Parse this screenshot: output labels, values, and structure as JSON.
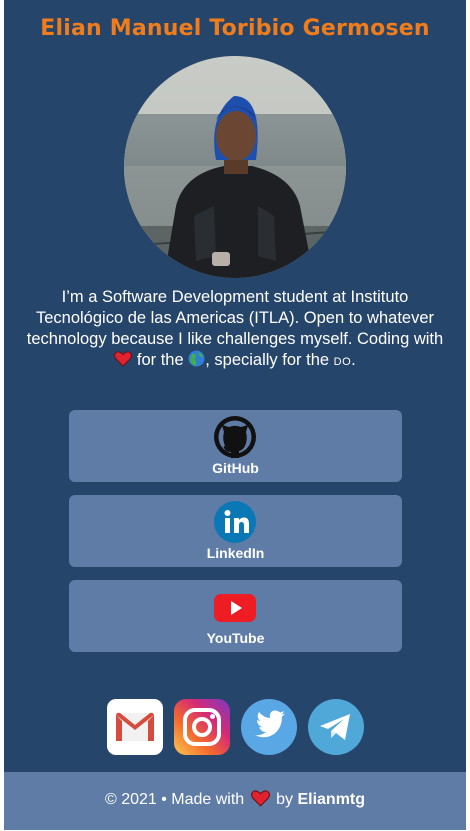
{
  "profile": {
    "name": "Elian Manuel Toribio Germosen",
    "bio": {
      "line1": "I’m a Software Development student at Instituto",
      "line2": "Tecnológico de las Americas (ITLA). Open to whatever",
      "line3": "technology because I like challenges myself. Coding with",
      "part_for_the": "for the",
      "part_specially": ", specially for the",
      "part_do": "DO",
      "part_end": "."
    }
  },
  "links": [
    {
      "label": "GitHub",
      "icon": "github-icon"
    },
    {
      "label": "LinkedIn",
      "icon": "linkedin-icon"
    },
    {
      "label": "YouTube",
      "icon": "youtube-icon"
    }
  ],
  "social": [
    "gmail-icon",
    "instagram-icon",
    "twitter-icon",
    "telegram-icon"
  ],
  "footer": {
    "copyright": "© 2021 • Made with",
    "by": "by",
    "author": "Elianmtg"
  },
  "colors": {
    "background": "#26456a",
    "card": "#5f7ca6",
    "title": "#f07c1c"
  }
}
